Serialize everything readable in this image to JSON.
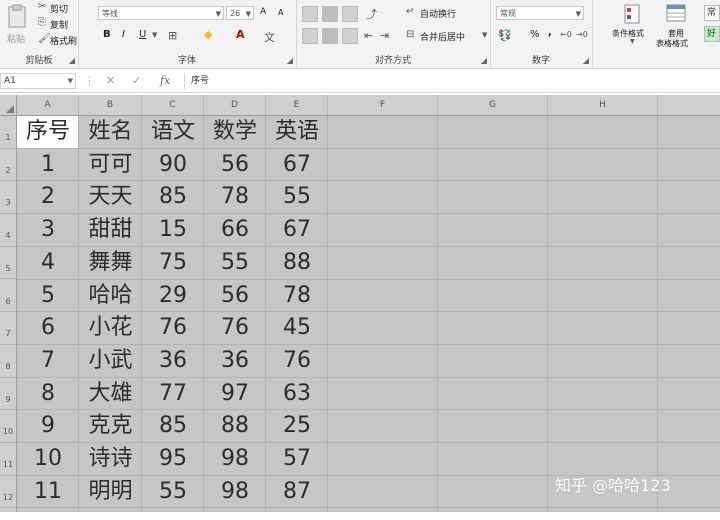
{
  "ribbon": {
    "clipboard": {
      "paste_label": "粘贴",
      "cut_label": "剪切",
      "copy_label": "复制",
      "format_painter_label": "格式刷",
      "group_label": "剪贴板"
    },
    "font": {
      "font_name": "等线",
      "font_size": "26",
      "grow_label": "A",
      "shrink_label": "A",
      "bold_label": "B",
      "italic_label": "I",
      "underline_label": "U",
      "group_label": "字体"
    },
    "alignment": {
      "wrap_text_label": "自动换行",
      "merge_center_label": "合并后居中",
      "group_label": "对齐方式"
    },
    "number": {
      "format_value": "常规",
      "percent_label": "%",
      "comma_label": ",",
      "group_label": "数字"
    },
    "styles": {
      "conditional_format_label": "条件格式",
      "format_as_table_label_line1": "套用",
      "format_as_table_label_line2": "表格格式",
      "style_preview_top": "常",
      "style_good_label": "好"
    }
  },
  "formula_bar": {
    "name_box": "A1",
    "cancel_icon": "✕",
    "enter_icon": "✓",
    "fx_label": "fx",
    "content": "序号"
  },
  "columns": [
    "A",
    "B",
    "C",
    "D",
    "E",
    "F",
    "G",
    "H"
  ],
  "rows": [
    "1",
    "2",
    "3",
    "4",
    "5",
    "6",
    "7",
    "8",
    "9",
    "10",
    "11",
    "12"
  ],
  "table": {
    "headers": [
      "序号",
      "姓名",
      "语文",
      "数学",
      "英语"
    ],
    "rows": [
      [
        "1",
        "可可",
        "90",
        "56",
        "67"
      ],
      [
        "2",
        "天天",
        "85",
        "78",
        "55"
      ],
      [
        "3",
        "甜甜",
        "15",
        "66",
        "67"
      ],
      [
        "4",
        "舞舞",
        "75",
        "55",
        "88"
      ],
      [
        "5",
        "哈哈",
        "29",
        "56",
        "78"
      ],
      [
        "6",
        "小花",
        "76",
        "76",
        "45"
      ],
      [
        "7",
        "小武",
        "36",
        "36",
        "76"
      ],
      [
        "8",
        "大雄",
        "77",
        "97",
        "63"
      ],
      [
        "9",
        "克克",
        "85",
        "88",
        "25"
      ],
      [
        "10",
        "诗诗",
        "95",
        "98",
        "57"
      ],
      [
        "11",
        "明明",
        "55",
        "98",
        "87"
      ]
    ]
  },
  "watermark": "知乎 @哈哈123",
  "colors": {
    "selection_grey": "#c6c6c6",
    "header_grey": "#cfcfcf",
    "active_cell": "#ffffff",
    "ribbon_bg": "#f3f3f3",
    "style_good_green": "#c6efce"
  }
}
